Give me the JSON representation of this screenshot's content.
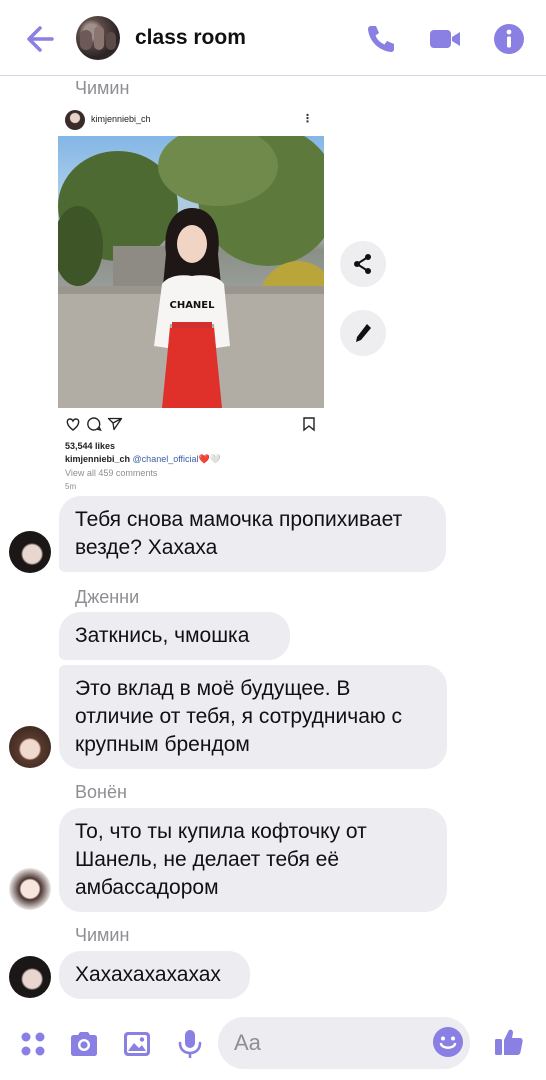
{
  "header": {
    "title": "class room",
    "accent_color": "#8a7fe2"
  },
  "post": {
    "username": "kimjenniebi_ch",
    "likes": "53,544 likes",
    "caption_user": "kimjenniebi_ch",
    "caption_tag": "@chanel_official",
    "caption_emoji": "❤️🤍",
    "comments": "View all 459 comments",
    "time": "5m",
    "sweater_text": "CHANEL"
  },
  "messages": [
    {
      "sender": "Чимин",
      "text": "Тебя снова мамочка пропихивает везде? Хахаха"
    },
    {
      "sender": "Дженни",
      "text": "Заткнись, чмошка"
    },
    {
      "sender": "",
      "text": "Это вклад в моё будущее. В отличие от тебя, я сотрудничаю с крупным брендом"
    },
    {
      "sender": "Вонён",
      "text": "То, что ты купила кофточку от Шанель, не делает тебя её амбассадором"
    },
    {
      "sender": "Чимин",
      "text": "Хахахахахахах"
    }
  ],
  "composer": {
    "placeholder": "Aa"
  }
}
